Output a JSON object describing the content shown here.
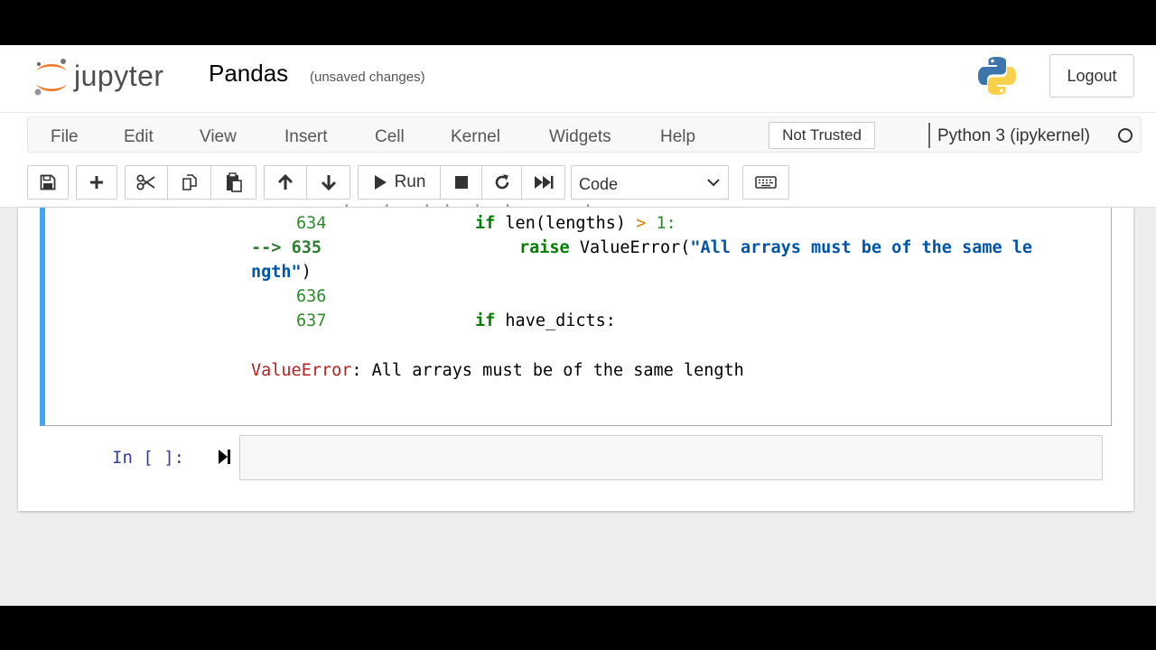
{
  "header": {
    "app_name": "jupyter",
    "notebook_name": "Pandas",
    "save_status": "(unsaved changes)",
    "logout_label": "Logout"
  },
  "menubar": {
    "items": [
      "File",
      "Edit",
      "View",
      "Insert",
      "Cell",
      "Kernel",
      "Widgets",
      "Help"
    ],
    "trust_label": "Not Trusted",
    "kernel_name": "Python 3 (ipykernel)"
  },
  "toolbar": {
    "run_label": "Run",
    "cell_type": "Code",
    "icons": [
      "save-icon",
      "plus-icon",
      "scissors-icon",
      "copy-icon",
      "paste-icon",
      "arrow-up-icon",
      "arrow-down-icon",
      "play-icon",
      "stop-icon",
      "restart-icon",
      "fast-forward-icon",
      "keyboard-icon"
    ]
  },
  "traceback": {
    "lines": [
      {
        "num": "634",
        "code_kw": "if",
        "code_rest": " len(lengths) ",
        "op": ">",
        "num_lit": " 1:"
      },
      {
        "arrow": "-->",
        "num": "635",
        "code_kw": "raise",
        "code_rest": " ValueError(",
        "str": "\"All arrays must be of the same le"
      },
      {
        "wrap_str": "ngth\"",
        "wrap_end": ")"
      },
      {
        "num": "636"
      },
      {
        "num": "637",
        "code_kw": "if",
        "code_rest": " have_dicts:"
      }
    ],
    "error_type": "ValueError",
    "error_message": ": All arrays must be of the same length"
  },
  "empty_cell": {
    "prompt": "In [ ]:"
  },
  "colors": {
    "selected_cell_border": "#42a5f5",
    "prompt_color": "#303f9f",
    "error_name_color": "#b22222",
    "keyword_color": "#008000",
    "string_color": "#0055aa"
  }
}
